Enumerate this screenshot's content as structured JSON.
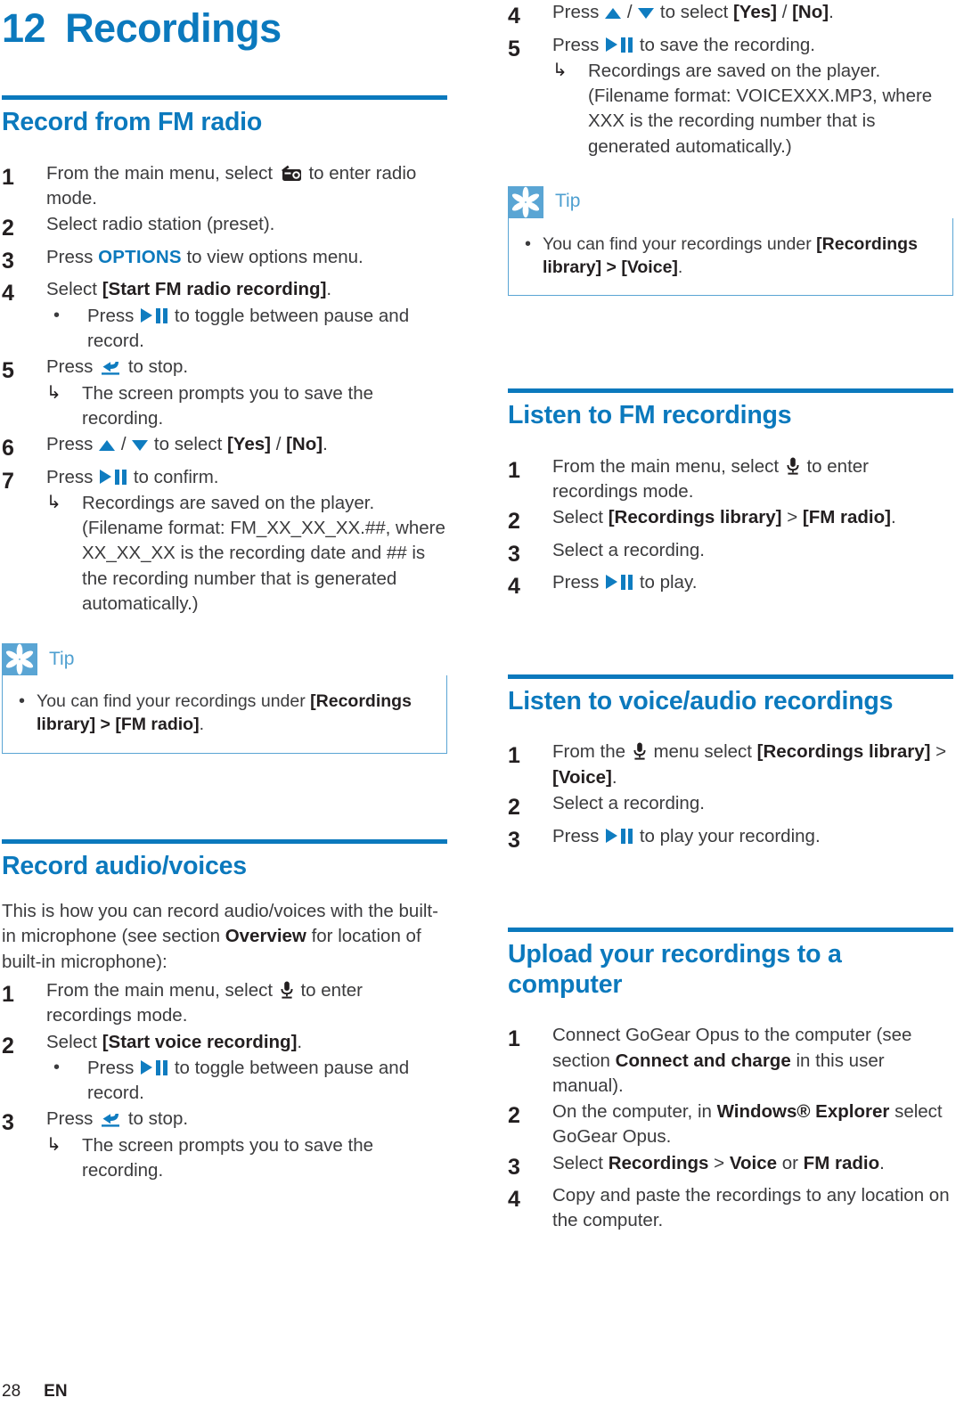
{
  "chapter": {
    "number": "12",
    "title": "Recordings"
  },
  "footer": {
    "page_number": "28",
    "language": "EN"
  },
  "icons": {
    "play_pause": "play-pause-icon",
    "up": "up-arrow-icon",
    "down": "down-arrow-icon",
    "back": "back-arrow-icon",
    "mic": "microphone-icon",
    "radio": "radio-icon",
    "tip": "tip-asterisk-icon",
    "result_arrow": "↳",
    "bullet": "•"
  },
  "colors": {
    "brand_blue": "#0b79bd",
    "icon_blue": "#0f7cc0",
    "tip_blue": "#5aa5d4",
    "body_text": "#3b3b3d"
  },
  "sections": {
    "record_fm": {
      "heading": "Record from FM radio",
      "steps": {
        "s1_a": "From the main menu, select",
        "s1_b": "to enter radio mode.",
        "s2": "Select radio station (preset).",
        "s3_a": "Press",
        "s3_key": "OPTIONS",
        "s3_b": "to view options menu.",
        "s4_a": "Select",
        "s4_bold": "[Start FM radio recording]",
        "s4_b": ".",
        "s4_sub_a": "Press",
        "s4_sub_b": "to toggle between pause and record.",
        "s5_a": "Press",
        "s5_b": "to stop.",
        "s5_result": "The screen prompts you to save the recording.",
        "s6_a": "Press",
        "s6_mid": "/",
        "s6_b": "to select",
        "s6_yes": "[Yes]",
        "s6_slash": "/",
        "s6_no": "[No]",
        "s6_end": ".",
        "s7_a": "Press",
        "s7_b": "to confirm.",
        "s7_result": "Recordings are saved on the player. (Filename format: FM_XX_XX_XX.##, where XX_XX_XX is the recording date and ## is the recording number that is generated automatically.)"
      },
      "tip": {
        "label": "Tip",
        "text_a": "You can find your recordings under",
        "text_bold1": "[Recordings library]",
        "text_gt": ">",
        "text_bold2": "[FM radio]",
        "text_end": "."
      }
    },
    "record_audio": {
      "heading": "Record audio/voices",
      "intro_a": "This is how you can record audio/voices with the built-in microphone (see section",
      "intro_bold": "Overview",
      "intro_b": "for location of built-in microphone):",
      "steps": {
        "s1_a": "From the main menu, select",
        "s1_b": "to enter recordings mode.",
        "s2_a": "Select",
        "s2_bold": "[Start voice recording]",
        "s2_b": ".",
        "s2_sub_a": "Press",
        "s2_sub_b": "to toggle between pause and record.",
        "s3_a": "Press",
        "s3_b": "to stop.",
        "s3_result": "The screen prompts you to save the recording."
      }
    },
    "record_audio_cont": {
      "steps": {
        "s4_a": "Press",
        "s4_mid": "/",
        "s4_b": "to select",
        "s4_yes": "[Yes]",
        "s4_slash": "/",
        "s4_no": "[No]",
        "s4_end": ".",
        "s5_a": "Press",
        "s5_b": "to save the recording.",
        "s5_result": "Recordings are saved on the player. (Filename format: VOICEXXX.MP3, where XXX is the recording number that is generated automatically.)"
      },
      "tip": {
        "label": "Tip",
        "text_a": "You can find your recordings under",
        "text_bold1": "[Recordings library]",
        "text_gt": ">",
        "text_bold2": "[Voice]",
        "text_end": "."
      }
    },
    "listen_fm": {
      "heading": "Listen to FM recordings",
      "steps": {
        "s1_a": "From the main menu, select",
        "s1_b": "to enter recordings mode.",
        "s2_a": "Select",
        "s2_bold1": "[Recordings library]",
        "s2_gt": ">",
        "s2_bold2": "[FM radio]",
        "s2_end": ".",
        "s3": "Select a recording.",
        "s4_a": "Press",
        "s4_b": "to play."
      }
    },
    "listen_voice": {
      "heading": "Listen to voice/audio recordings",
      "steps": {
        "s1_a": "From the",
        "s1_b": "menu select",
        "s1_bold1": "[Recordings library]",
        "s1_gt": ">",
        "s1_bold2": "[Voice]",
        "s1_end": ".",
        "s2": "Select a recording.",
        "s3_a": "Press",
        "s3_b": "to play your recording."
      }
    },
    "upload": {
      "heading": "Upload your recordings to a computer",
      "steps": {
        "s1_a": "Connect GoGear Opus to the computer (see section",
        "s1_bold": "Connect and charge",
        "s1_b": "in this user manual).",
        "s2_a": "On the computer, in",
        "s2_bold": "Windows® Explorer",
        "s2_b": "select GoGear Opus.",
        "s3_a": "Select",
        "s3_bold1": "Recordings",
        "s3_gt": ">",
        "s3_bold2": "Voice",
        "s3_or": "or",
        "s3_bold3": "FM radio",
        "s3_end": ".",
        "s4": "Copy and paste the recordings to any location on the computer."
      }
    }
  }
}
